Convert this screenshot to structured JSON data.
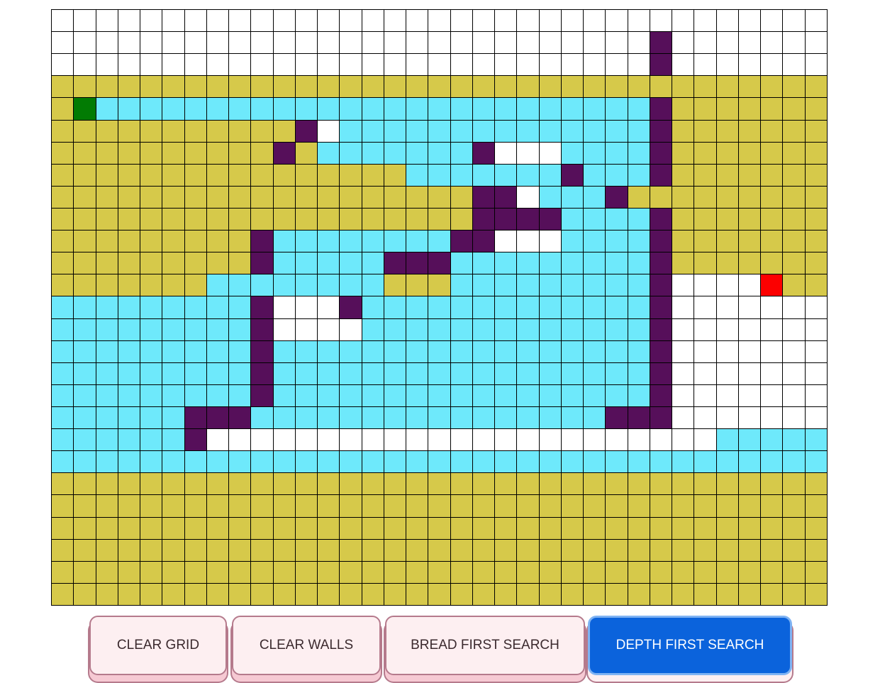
{
  "colors": {
    "empty": "#ffffff",
    "wall": "#560f5a",
    "visited": "#d6c94a",
    "path": "#6ee9fb",
    "start": "#027b03",
    "end": "#fc0000",
    "button_bg": "#fdeff1",
    "button_active_bg": "#0b63dc"
  },
  "legend": {
    ".": "empty",
    "W": "wall",
    "Y": "visited",
    "C": "path",
    "S": "start",
    "E": "end"
  },
  "grid": {
    "rows": [
      "...................................",
      "...........................W.......",
      "...........................W.......",
      "YYYYYYYYYYYYYYYYYYYYYYYYYYYYYYYYYYY",
      "YSCCCCCCCCCCCCCCCCCCCCCCCCCWYYYYYYY",
      "YYYYYYYYYYYW.CCCCCCCCCCCCCCWYYYYYYY",
      "YYYYYYYYYYWYCCCCCCCW...CCCCWYYYYYYY",
      "YYYYYYYYYYYYYYYYCCCCCCCWCCCWYYYYYYY",
      "YYYYYYYYYYYYYYYYYYYWW.CCCWYYYYYYYYY",
      "YYYYYYYYYYYYYYYYYYYWWWWCCCCWYYYYYYY",
      "YYYYYYYYYWCCCCCCCCWW...CCCCWYYYYYYY",
      "YYYYYYYYYWCCCCCWWWCCCCCCCCCWYYYYYYY",
      "YYYYYYYCCCCCCCCYYYCCCCCCCCCW....EYY",
      "CCCCCCCCCW...WCCCCCCCCCCCCCW.......",
      "CCCCCCCCCW....CCCCCCCCCCCCCW.......",
      "CCCCCCCCCWCCCCCCCCCCCCCCCCCW.......",
      "CCCCCCCCCWCCCCCCCCCCCCCCCCCW.......",
      "CCCCCCCCCWCCCCCCCCCCCCCCCCCW.......",
      "CCCCCCWWWCCCCCCCCCCCCCCCCWWW.......",
      "CCCCCCW.......................CCCCCCCCCCCC",
      "CCCCCCCCCCCCCCCCCCCCCCCCCCCCCCCCCCC",
      "YYYYYYYYYYYYYYYYYYYYYYYYYYYYYYYYYYY",
      "YYYYYYYYYYYYYYYYYYYYYYYYYYYYYYYYYYY",
      "YYYYYYYYYYYYYYYYYYYYYYYYYYYYYYYYYYY",
      "YYYYYYYYYYYYYYYYYYYYYYYYYYYYYYYYYYY",
      "YYYYYYYYYYYYYYYYYYYYYYYYYYYYYYYYYYY",
      "YYYYYYYYYYYYYYYYYYYYYYYYYYYYYYYYYYY"
    ]
  },
  "buttons": {
    "clear_grid": "CLEAR GRID",
    "clear_walls": "CLEAR WALLS",
    "bfs": "BREAD FIRST SEARCH",
    "dfs": "DEPTH FIRST SEARCH"
  }
}
